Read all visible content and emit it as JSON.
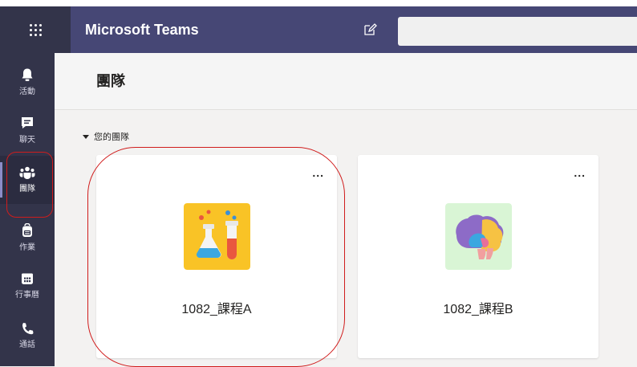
{
  "app": {
    "title": "Microsoft Teams",
    "search": {
      "placeholder": ""
    }
  },
  "rail": {
    "items": [
      {
        "id": "activity",
        "label": "活動",
        "icon": "bell-icon",
        "active": false
      },
      {
        "id": "chat",
        "label": "聊天",
        "icon": "chat-icon",
        "active": false
      },
      {
        "id": "teams",
        "label": "團隊",
        "icon": "teams-icon",
        "active": true
      },
      {
        "id": "assignments",
        "label": "作業",
        "icon": "backpack-icon",
        "active": false
      },
      {
        "id": "calendar",
        "label": "行事曆",
        "icon": "calendar-icon",
        "active": false
      },
      {
        "id": "calls",
        "label": "通話",
        "icon": "phone-icon",
        "active": false
      }
    ]
  },
  "main": {
    "title": "團隊",
    "section_label": "您的團隊",
    "teams": [
      {
        "name": "1082_課程A",
        "avatar_icon": "science-lab-icon",
        "avatar_color": "#f9c326",
        "more_label": "..."
      },
      {
        "name": "1082_課程B",
        "avatar_icon": "brain-icon",
        "avatar_color": "#d9f5d5",
        "more_label": "..."
      }
    ]
  },
  "colors": {
    "topbar": "#464775",
    "rail": "#33344a",
    "highlight": "#d01c1c"
  }
}
